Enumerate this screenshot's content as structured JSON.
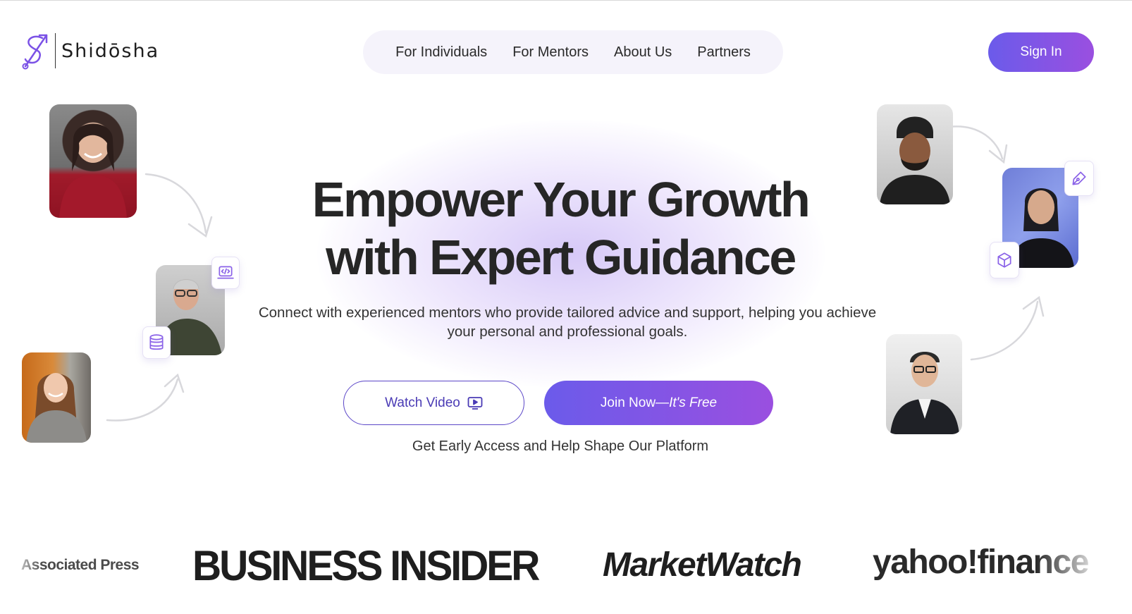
{
  "brand": {
    "name": "Shidōsha",
    "accent": "#7b52e6",
    "gradient_start": "#6b5bea",
    "gradient_end": "#9a4fe0"
  },
  "nav": {
    "items": [
      {
        "label": "For Individuals"
      },
      {
        "label": "For Mentors"
      },
      {
        "label": "About Us"
      },
      {
        "label": "Partners"
      }
    ]
  },
  "header": {
    "signin_label": "Sign In"
  },
  "hero": {
    "headline_line1": "Empower Your Growth",
    "headline_line2": "with Expert Guidance",
    "subtext": "Connect with experienced mentors who provide tailored advice and support, helping you achieve your personal and professional goals.",
    "watch_label": "Watch Video",
    "watch_icon": "play-screen-icon",
    "join_label": "Join Now—",
    "join_emphasis": "It's Free",
    "early_access": "Get Early Access and Help Shape Our Platform"
  },
  "mentor_icons": [
    "code-laptop-icon",
    "database-icon",
    "pen-nib-icon",
    "cube-icon"
  ],
  "press": {
    "logos": [
      {
        "name": "Associated Press"
      },
      {
        "name": "BUSINESS INSIDER"
      },
      {
        "name": "MarketWatch"
      },
      {
        "name": "yahoo!finance"
      }
    ]
  }
}
